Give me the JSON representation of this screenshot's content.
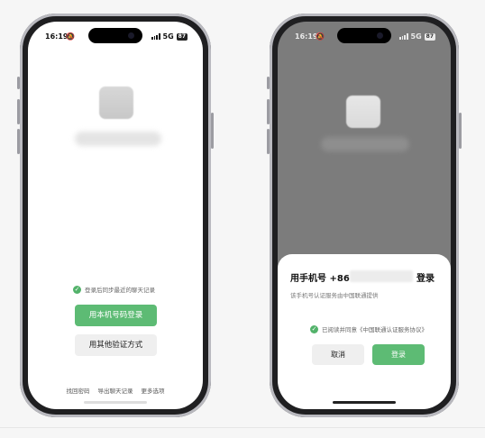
{
  "status": {
    "time": "16:19",
    "network": "5G",
    "battery": "87"
  },
  "left_screen": {
    "sync_notice": "登录后同步最近的聊天记录",
    "primary_button": "用本机号码登录",
    "secondary_button": "用其他验证方式",
    "footer_links": [
      "找回密码",
      "导出聊天记录",
      "更多选项"
    ]
  },
  "right_screen": {
    "sheet": {
      "title_prefix": "用手机号 +86",
      "title_suffix": "登录",
      "subtitle": "该手机号认证服务由中国联通提供",
      "agreement": "已阅读并同意《中国联通认证服务协议》",
      "cancel_button": "取消",
      "login_button": "登录"
    }
  },
  "colors": {
    "accent_green": "#52b26a",
    "button_green": "#5dbb74",
    "dim_overlay": "#7c7c7c"
  }
}
